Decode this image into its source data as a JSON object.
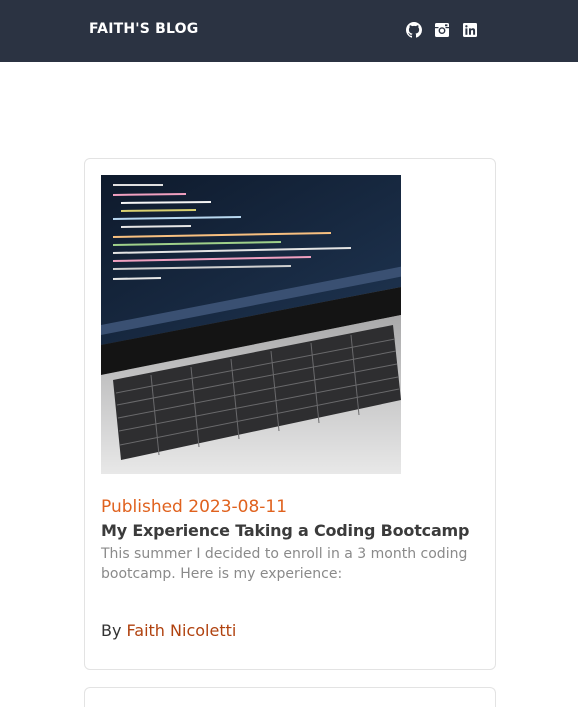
{
  "header": {
    "brand": "FAITH'S BLOG",
    "social": [
      {
        "icon": "github-icon"
      },
      {
        "icon": "instagram-icon"
      },
      {
        "icon": "linkedin-icon"
      }
    ]
  },
  "post": {
    "image_icon": "laptop-code-photo",
    "published": "Published 2023-08-11",
    "title": "My Experience Taking a Coding Bootcamp",
    "excerpt": "This summer I decided to enroll in a 3 month coding bootcamp. Here is my experience:",
    "by_label": "By",
    "author": "Faith Nicoletti"
  },
  "colors": {
    "navbar": "#2b3342",
    "accent": "#e0621e",
    "author": "#b0420f"
  }
}
